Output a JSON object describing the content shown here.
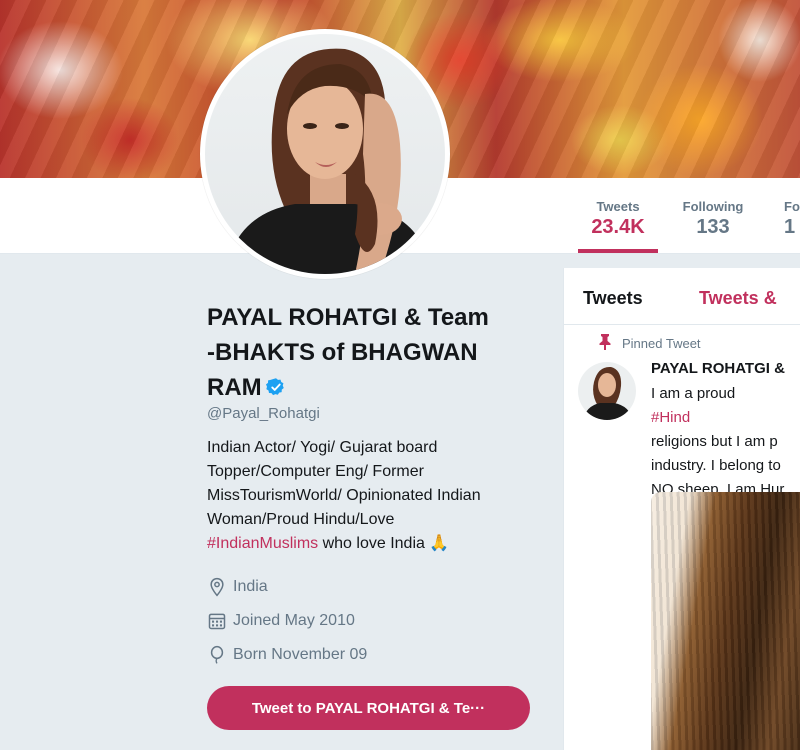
{
  "profile": {
    "name_lines": [
      "PAYAL ROHATGI & Team",
      "-BHAKTS of BHAGWAN",
      "RAM"
    ],
    "handle": "@Payal_Rohatgi",
    "bio_lines": [
      "Indian Actor/ Yogi/ Gujarat board",
      "Topper/Computer Eng/ Former",
      "MissTourismWorld/ Opinionated Indian",
      "Woman/Proud Hindu/Love"
    ],
    "bio_hashtag": "#IndianMuslims",
    "bio_tail": " who love India 🙏",
    "location": "India",
    "joined": "Joined May 2010",
    "born": "Born November 09",
    "tweet_to_button": "Tweet to PAYAL ROHATGI & Te···",
    "verified_icon": "verified-badge-icon"
  },
  "nav": {
    "items": [
      {
        "label": "Tweets",
        "count": "23.4K",
        "active": true
      },
      {
        "label": "Following",
        "count": "133",
        "active": false
      },
      {
        "label": "Fo",
        "count": "1",
        "active": false
      }
    ]
  },
  "timeline": {
    "tabs": [
      "Tweets",
      "Tweets &"
    ],
    "pinned_label": "Pinned Tweet",
    "tweet_author": "PAYAL ROHATGI &",
    "tweet_text_lines": [
      "I am a proud ",
      "religions but I am p",
      "industry. I belong to",
      "NO sheep. I am Hur"
    ],
    "tweet_hashtag_fragment": "#Hind"
  },
  "colors": {
    "accent": "#c1305d",
    "verified": "#1da1f2",
    "muted": "#657786",
    "background": "#e6ecf0"
  }
}
